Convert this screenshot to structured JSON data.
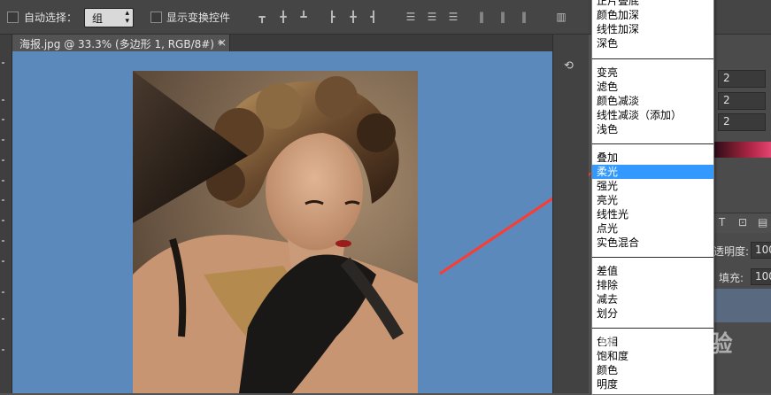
{
  "options_bar": {
    "auto_select_label": "自动选择：",
    "auto_select_value": "组",
    "show_transform_label": "显示变换控件"
  },
  "document": {
    "tab_title": "海报.jpg @ 33.3% (多边形 1, RGB/8#) *",
    "tab_close": "×"
  },
  "right_panel": {
    "values": [
      "2",
      "2",
      "2"
    ],
    "opacity_label": "透明度:",
    "opacity_value": "100",
    "fill_label": "填充:",
    "fill_value": "100"
  },
  "blend_menu": {
    "groups": [
      [
        "正片叠底",
        "颜色加深",
        "线性加深",
        "深色"
      ],
      [
        "变亮",
        "滤色",
        "颜色减淡",
        "线性减淡（添加）",
        "浅色"
      ],
      [
        "叠加",
        "柔光",
        "强光",
        "亮光",
        "线性光",
        "点光",
        "实色混合"
      ],
      [
        "差值",
        "排除",
        "减去",
        "划分"
      ],
      [
        "色相",
        "饱和度",
        "颜色",
        "明度"
      ]
    ],
    "selected": "柔光"
  },
  "colors": {
    "canvas_bg": "#5c89bc",
    "menu_highlight": "#3399ff",
    "arrow": "#ff3b2f"
  },
  "watermark": "Baidu 经验"
}
